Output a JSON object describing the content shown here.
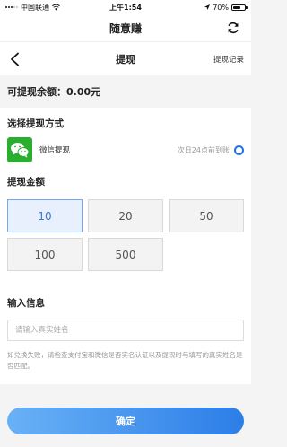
{
  "status_bar": {
    "carrier": "中国联通",
    "time": "上午1:54",
    "battery": "70%",
    "battery_level": 0.7
  },
  "app": {
    "title": "随意赚"
  },
  "nav": {
    "title": "提现",
    "records_label": "提现记录"
  },
  "balance": {
    "label": "可提现余额：0.00元"
  },
  "method": {
    "title": "选择提现方式",
    "option_label": "微信提现",
    "note": "次日24点前到账"
  },
  "amount": {
    "title": "提现金额",
    "options": [
      "10",
      "20",
      "50",
      "100",
      "500"
    ],
    "selected": "10"
  },
  "info": {
    "title": "输入信息",
    "name_placeholder": "请输入真实姓名",
    "hint": "如兑换失败，请检查支付宝和微信是否实名认证以及提现时与填写的真实姓名是否匹配。"
  },
  "confirm_label": "确定",
  "colors": {
    "accent": "#2c7ee8",
    "wechat": "#2aae2f",
    "selected_bg": "#e7f0fc"
  }
}
